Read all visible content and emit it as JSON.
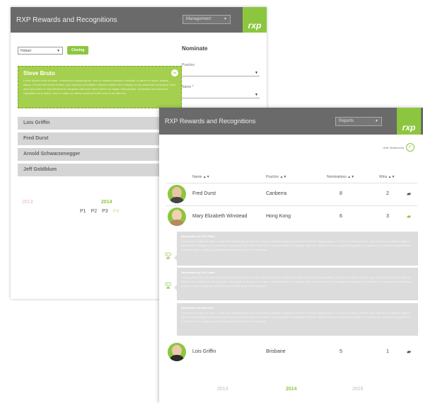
{
  "app_title": "RXP Rewards and Recognitions",
  "logo_text": "rxp",
  "back": {
    "header_dropdown": "Management",
    "office_select": "Hobart",
    "closing_button": "Closing",
    "featured": {
      "name": "Steve Bruto",
      "text": "Lorem ipsum dolor sit amet, consectetur adipiscing elit, sed do eiusmod tempor incididunt ut labore et dolore magna aliqua. Ut enim ad minim veniam, quis nostrud exercitation ullamco laboris nisi ut aliquip ex ea commodo consequat. Duis aute irure dolor in reprehenderit in voluptate velit esse cillum dolore eu fugiat nulla pariatur. Excepteur sint occaecat cupidatat non proident, sunt in culpa qui officia deserunt mollit anim id est laborum."
    },
    "people": [
      "Lois Griffin",
      "Fred Durst",
      "Arnold Schwarzenegger",
      "Jeff Goldblum"
    ],
    "nominate": {
      "title": "Nominate",
      "practice_label": "Practice",
      "name_label": "Name *"
    },
    "years": [
      "2013",
      "2014"
    ],
    "pages": [
      "P1",
      "P2",
      "P3",
      "P4"
    ],
    "next_arrow": "›"
  },
  "front": {
    "header_dropdown": "Reports",
    "toggle_label": "Hide Statements",
    "columns": [
      "Name ▲▼",
      "Practice ▲▼",
      "Nominations ▲▼",
      "Wins ▲▼"
    ],
    "rows": [
      {
        "name": "Fred Durst",
        "practice": "Canberra",
        "nominations": "8",
        "wins": "2"
      },
      {
        "name": "Mary Elizabeth Winstead",
        "practice": "Hong Kong",
        "nominations": "6",
        "wins": "3"
      },
      {
        "name": "Lois Griffin",
        "practice": "Brisbane",
        "nominations": "5",
        "wins": "1"
      }
    ],
    "nominations": [
      {
        "title": "Nomination by Tom Hard",
        "text": "Lorem ipsum dolor sit amet, consectetur adipiscing elit, sed do eiusmod tempor incididunt ut labore et dolore magna aliqua. Ut enim ad minim veniam, quis nostrud exercitation ullamco laboris nisi ut aliquip ex ea commodo consequat. Duis aute irure dolor in reprehenderit in voluptate velit esse cillum dolore eu fugiat nulla pariatur. Excepteur sint occaecat cupidatat non proident, sunt in culpa qui officia deserunt mollit anim id est laborum."
      },
      {
        "title": "Nomination by Tim Shaw",
        "text": "Lorem ipsum dolor sit amet, consectetur adipiscing elit, sed do eiusmod tempor incididunt ut labore et dolore magna aliqua. Ut enim ad minim veniam, quis nostrud exercitation ullamco laboris nisi ut aliquip ex ea commodo consequat. Duis aute irure dolor in reprehenderit in voluptate velit esse cillum dolore eu fugiat nulla pariatur. Excepteur sint occaecat cupidatat non proident, sunt in culpa qui officia deserunt mollit anim id est laborum."
      },
      {
        "title": "Nomination by Sara Bell",
        "text": "Lorem ipsum dolor sit amet, consectetur adipiscing elit, sed do eiusmod tempor incididunt ut labore et dolore magna aliqua. Ut enim ad minim veniam, quis nostrud exercitation ullamco laboris nisi ut aliquip ex ea commodo consequat. Duis aute irure dolor in reprehenderit in voluptate velit esse cillum dolore eu fugiat nulla pariatur. Excepteur sint occaecat cupidatat non proident, sunt in culpa qui officia deserunt mollit anim id est laborum."
      }
    ],
    "years": [
      "2013",
      "2014",
      "2015"
    ]
  },
  "colors": {
    "accent": "#8cc63f",
    "header": "#6a6a6a",
    "card": "#d5d5d5",
    "nomination": "#dcdcdc"
  },
  "icons": {
    "trophy": "trophy-icon",
    "chat": "chat-icon",
    "check": "check-circle-icon",
    "minus": "minus-circle-icon"
  }
}
